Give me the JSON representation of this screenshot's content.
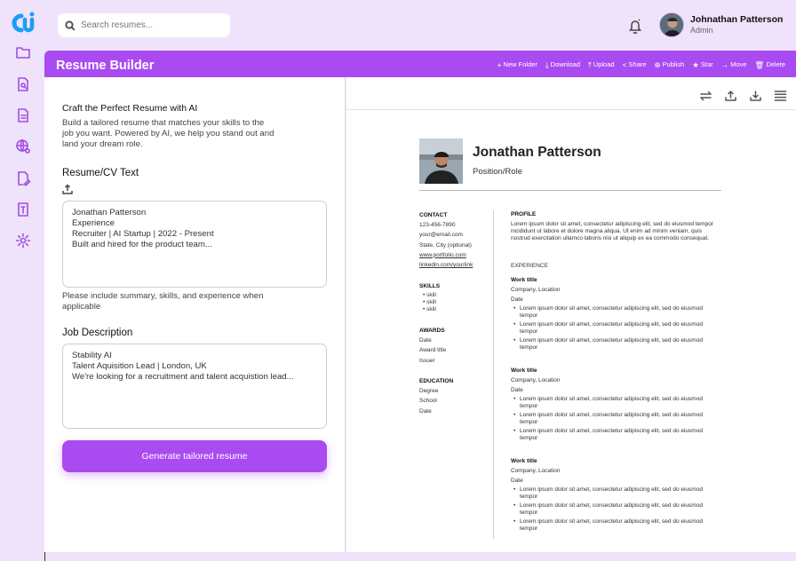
{
  "search": {
    "placeholder": "Search resumes..."
  },
  "user": {
    "name": "Johnathan Patterson",
    "role": "Admin"
  },
  "header": {
    "title": "Resume Builder",
    "actions": [
      {
        "label": "New Folder",
        "icon": "plus-icon"
      },
      {
        "label": "Download",
        "icon": "download-icon"
      },
      {
        "label": "Upload",
        "icon": "upload-icon"
      },
      {
        "label": "Share",
        "icon": "share-icon"
      },
      {
        "label": "Publish",
        "icon": "publish-icon"
      },
      {
        "label": "Star",
        "icon": "star-icon"
      },
      {
        "label": "Move",
        "icon": "arrow-right-icon"
      },
      {
        "label": "Delete",
        "icon": "trash-icon"
      }
    ]
  },
  "sidebar": {
    "icons": [
      "folder-icon",
      "document-search-icon",
      "document-icon",
      "globe-gear-icon",
      "document-edit-icon",
      "document-text-icon",
      "settings-icon"
    ]
  },
  "builder": {
    "heading": "Craft the Perfect Resume with AI",
    "description": "Build a tailored resume that matches your skills to the job you want. Powered by AI, we help you stand out and land your dream role.",
    "resume_label": "Resume/CV Text",
    "resume_text": "Jonathan Patterson\nExperience\nRecruiter | AI Startup | 2022 - Present\nBuilt and hired for the product team...",
    "resume_hint": "Please include summary, skills, and experience when applicable",
    "job_label": "Job Description",
    "job_text": "Stability AI\nTalent Aquisition Lead | London, UK\nWe're looking for a recruitment and talent acquistion lead...",
    "generate_label": "Generate tailored resume"
  },
  "preview": {
    "tools": [
      "swap-icon",
      "upload-icon",
      "download-icon",
      "menu-icon"
    ],
    "name": "Jonathan Patterson",
    "role": "Position/Role",
    "contact": {
      "heading": "CONTACT",
      "phone": "123-456-7890",
      "email": "your@email.com",
      "location": "State, City (optional)",
      "portfolio": "www.portfolio.com",
      "linkedin": "linkedin.com/yourlink"
    },
    "skills": {
      "heading": "SKILLS",
      "items": [
        "skill",
        "skill",
        "skill"
      ]
    },
    "awards": {
      "heading": "AWARDS",
      "date": "Date",
      "title": "Award title",
      "issuer": "Issuer"
    },
    "education": {
      "heading": "EDUCATION",
      "degree": "Degree",
      "school": "School",
      "date": "Date"
    },
    "profile": {
      "heading": "PROFILE",
      "text": "Lorem ipsum dolor sit amet, consectetur adipiscing elit, sed do eiusmod tempor incididunt ut labore et dolore magna aliqua. Ut enim ad minim veniam, quis nostrud exercitation ullamco laboris nisi ut aliquip ex ea commodo consequat."
    },
    "experience": {
      "heading": "EXPERIENCE",
      "jobs": [
        {
          "title": "Work title",
          "company": "Company, Location",
          "date": "Date",
          "bullets": [
            "Lorem ipsum dolor sit amet, consectetur adipiscing elit, sed do eiusmod tempor",
            "Lorem ipsum dolor sit amet, consectetur adipiscing elit, sed do eiusmod tempor",
            "Lorem ipsum dolor sit amet, consectetur adipiscing elit, sed do eiusmod tempor"
          ]
        },
        {
          "title": "Work title",
          "company": "Company, Location",
          "date": "Date",
          "bullets": [
            "Lorem ipsum dolor sit amet, consectetur adipiscing elit, sed do eiusmod tempor",
            "Lorem ipsum dolor sit amet, consectetur adipiscing elit, sed do eiusmod tempor",
            "Lorem ipsum dolor sit amet, consectetur adipiscing elit, sed do eiusmod tempor"
          ]
        },
        {
          "title": "Work title",
          "company": "Company, Location",
          "date": "Date",
          "bullets": [
            "Lorem ipsum dolor sit amet, consectetur adipiscing elit, sed do eiusmod tempor",
            "Lorem ipsum dolor sit amet, consectetur adipiscing elit, sed do eiusmod tempor",
            "Lorem ipsum dolor sit amet, consectetur adipiscing elit, sed do eiusmod tempor"
          ]
        }
      ]
    }
  },
  "colors": {
    "accent": "#a94bf0",
    "background": "#efe2fb"
  }
}
